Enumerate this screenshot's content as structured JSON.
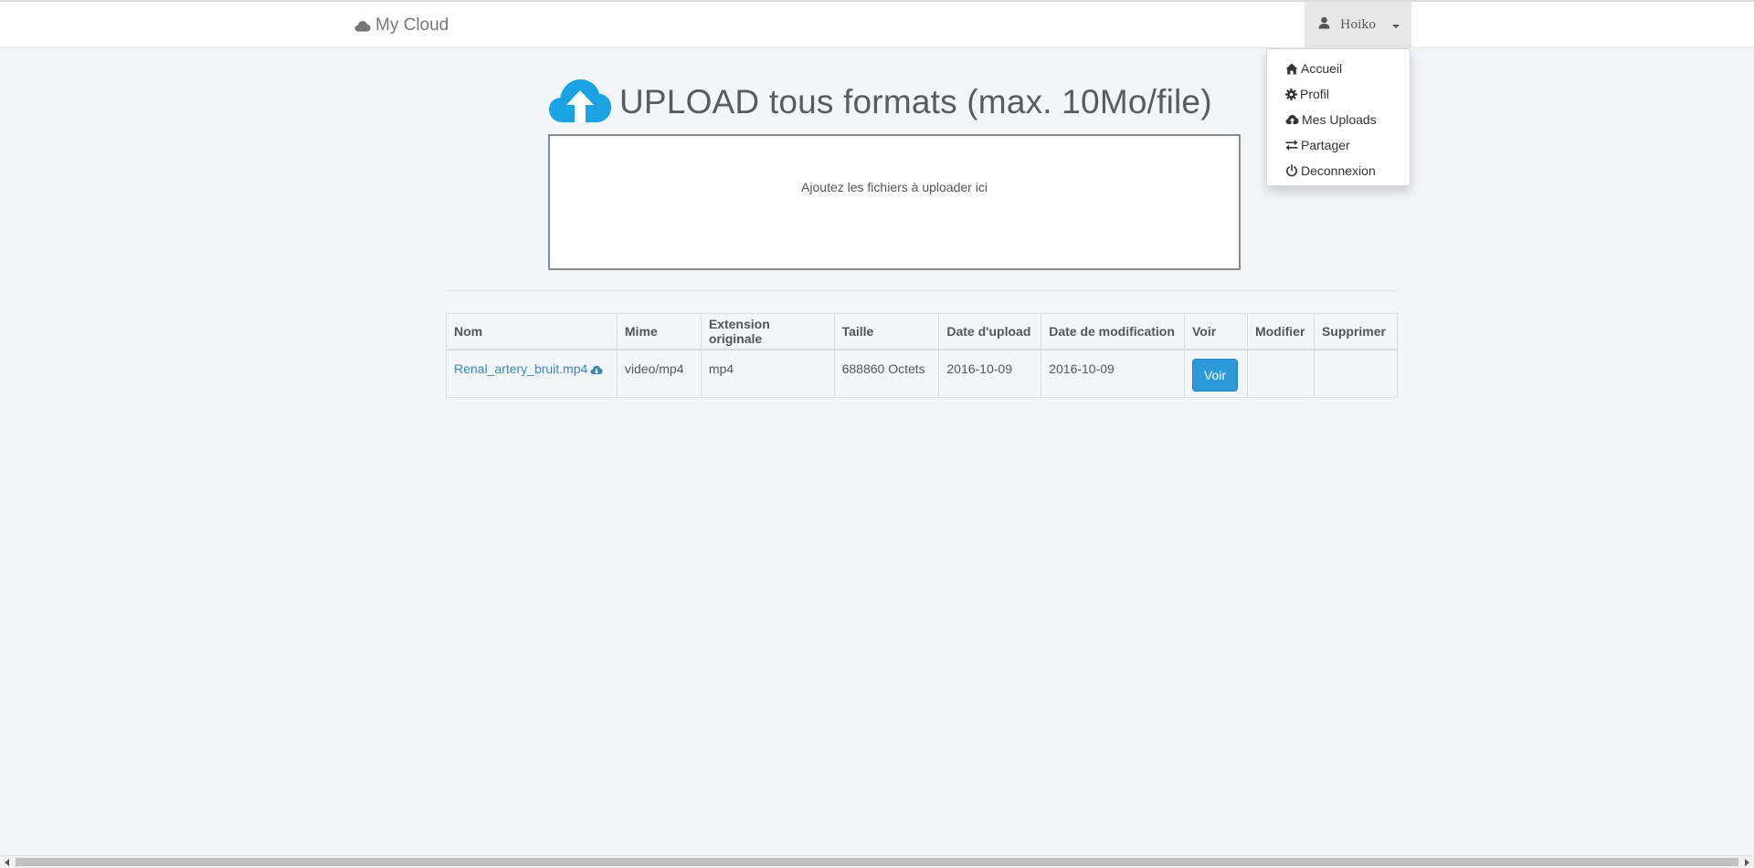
{
  "navbar": {
    "brand": "My Cloud",
    "brand_icon": "cloud-icon",
    "user_name": "Hoiko",
    "user_icon": "user-icon"
  },
  "user_menu": {
    "items": [
      {
        "label": "Accueil",
        "icon": "home-icon"
      },
      {
        "label": "Profil",
        "icon": "gear-icon"
      },
      {
        "label": "Mes Uploads",
        "icon": "cloud-upload-icon"
      },
      {
        "label": "Partager",
        "icon": "transfer-icon"
      },
      {
        "label": "Deconnexion",
        "icon": "power-icon"
      }
    ]
  },
  "upload": {
    "title": "UPLOAD tous formats (max. 10Mo/file)",
    "title_icon": "cloud-upload-icon",
    "dropzone_message": "Ajoutez les fichiers à uploader ici"
  },
  "files_table": {
    "headers": [
      "Nom",
      "Mime",
      "Extension originale",
      "Taille",
      "Date d'upload",
      "Date de modification",
      "Voir",
      "Modifier",
      "Supprimer"
    ],
    "rows": [
      {
        "name": "Renal_artery_bruit.mp4",
        "download_icon": "cloud-download-icon",
        "mime": "video/mp4",
        "extension": "mp4",
        "size": "688860 Octets",
        "upload_date": "2016-10-09",
        "modified_date": "2016-10-09",
        "view_label": "Voir",
        "edit": "",
        "delete": ""
      }
    ]
  },
  "colors": {
    "background": "#f3f6f9",
    "accent": "#2c9ad8",
    "link": "#3a86b5",
    "upload_icon": "#1aa3e0"
  }
}
